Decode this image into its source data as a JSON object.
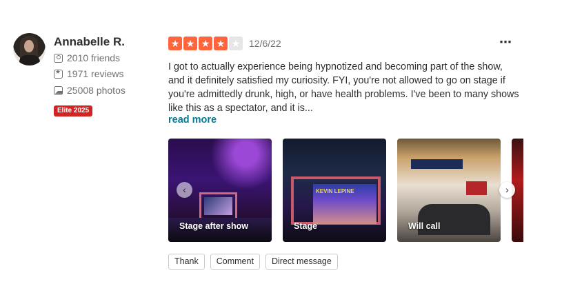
{
  "user": {
    "name": "Annabelle R.",
    "friends": "2010 friends",
    "reviews": "1971 reviews",
    "photos": "25008 photos",
    "elite_badge": "Elite 2025"
  },
  "review": {
    "rating": 4,
    "rating_max": 5,
    "star_glyph": "★",
    "date": "12/6/22",
    "more_menu": "⋯",
    "text": "I got to actually experience being hypnotized and becoming part of the show, and it definitely satisfied my curiosity. FYI, you're not allowed to go on stage if you're admittedly drunk, high, or have health problems. I've been to many shows like this as a spectator, and it is...",
    "read_more": "read more"
  },
  "photos": [
    {
      "caption": "Stage after show"
    },
    {
      "caption": "Stage",
      "screen_text": "KEVIN LEPINE"
    },
    {
      "caption": "Will call"
    },
    {
      "caption": ""
    }
  ],
  "carousel": {
    "prev_glyph": "‹",
    "next_glyph": "›"
  },
  "actions": {
    "thank": "Thank",
    "comment": "Comment",
    "direct_message": "Direct message"
  },
  "colors": {
    "star_on": "#ff643d",
    "star_off": "#e6e6e6",
    "elite": "#d32323",
    "link": "#027a97"
  }
}
